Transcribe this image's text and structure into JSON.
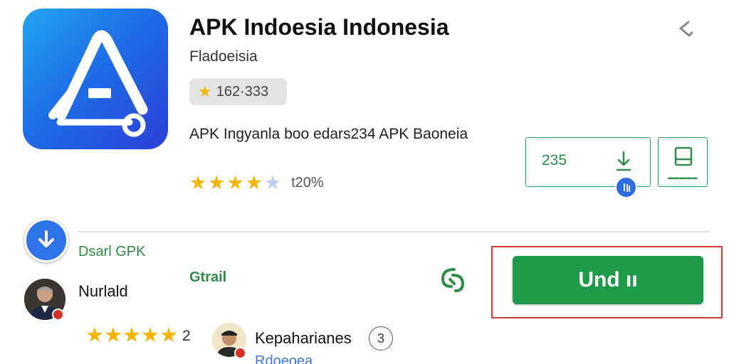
{
  "app": {
    "title": "APK Indoesia Indonesia",
    "developer": "Fladoeisia",
    "rating_chip": "162·333",
    "description": "APK Ingyanla boo edars234 APK Baoneia",
    "stars_value": 4.5,
    "rating_percent": "t20%"
  },
  "actions": {
    "size_value": "235",
    "install_label": "Und ıı"
  },
  "section": {
    "label": "Dsarl GPK",
    "detail_link": "Gtrail"
  },
  "reviews": [
    {
      "name": "Nurlald",
      "stars": 5,
      "count": "2"
    },
    {
      "name": "Kepaharianes",
      "count_badge": "3",
      "subtitle": "Rdoeoea"
    }
  ],
  "icons": {
    "app": "stylized-a-logo-icon",
    "share": "share-icon",
    "download": "download-icon",
    "bookmark": "save-icon",
    "refresh": "refresh-icon"
  },
  "colors": {
    "accent_green": "#1e9a4a",
    "accent_blue": "#2f74e6",
    "star": "#f4b400",
    "highlight_outline": "#d13a3a"
  }
}
